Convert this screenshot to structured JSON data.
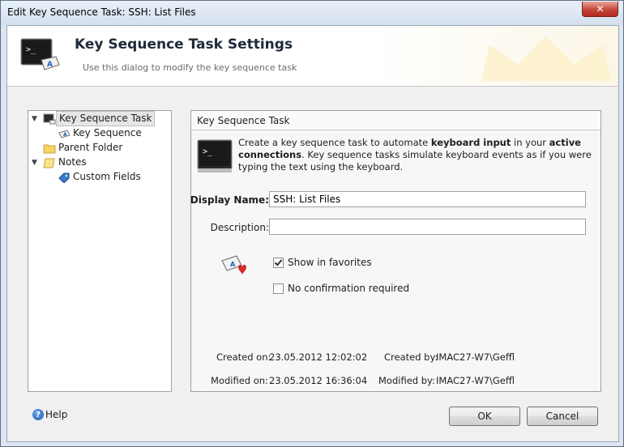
{
  "window": {
    "title": "Edit Key Sequence Task: SSH: List Files",
    "close_label": "✕"
  },
  "header": {
    "title": "Key Sequence Task Settings",
    "subtitle": "Use this dialog to modify the key sequence task"
  },
  "tree": {
    "items": [
      {
        "label": "Key Sequence Task",
        "icon": "key-sequence-task-icon",
        "selected": true
      },
      {
        "label": "Key Sequence",
        "icon": "keyboard-icon"
      },
      {
        "label": "Parent Folder",
        "icon": "folder-icon"
      },
      {
        "label": "Notes",
        "icon": "notes-icon"
      },
      {
        "label": "Custom Fields",
        "icon": "tag-icon"
      }
    ]
  },
  "group": {
    "title": "Key Sequence Task",
    "info_part1": "Create a key sequence task to automate ",
    "info_bold1": "keyboard input",
    "info_part2": " in your ",
    "info_bold2": "active connections",
    "info_part3": ". Key sequence tasks simulate keyboard events as if you were typing the text using the keyboard."
  },
  "form": {
    "display_name_label": "Display Name:",
    "display_name_value": "SSH: List Files",
    "description_label": "Description:",
    "description_value": "",
    "show_in_favorites_label": "Show in favorites",
    "show_in_favorites_checked": true,
    "no_confirmation_label": "No confirmation required",
    "no_confirmation_checked": false
  },
  "meta": {
    "created_on_label": "Created on:",
    "created_on_value": "23.05.2012 12:02:02",
    "created_by_label": "Created by:",
    "created_by_value": "IMAC27-W7\\Geffl",
    "modified_on_label": "Modified on:",
    "modified_on_value": "23.05.2012 16:36:04",
    "modified_by_label": "Modified by:",
    "modified_by_value": "IMAC27-W7\\Geffl"
  },
  "buttons": {
    "help_label": "Help",
    "ok_label": "OK",
    "cancel_label": "Cancel"
  },
  "colors": {
    "accent": "#1e5db6",
    "close": "#c5463a"
  }
}
